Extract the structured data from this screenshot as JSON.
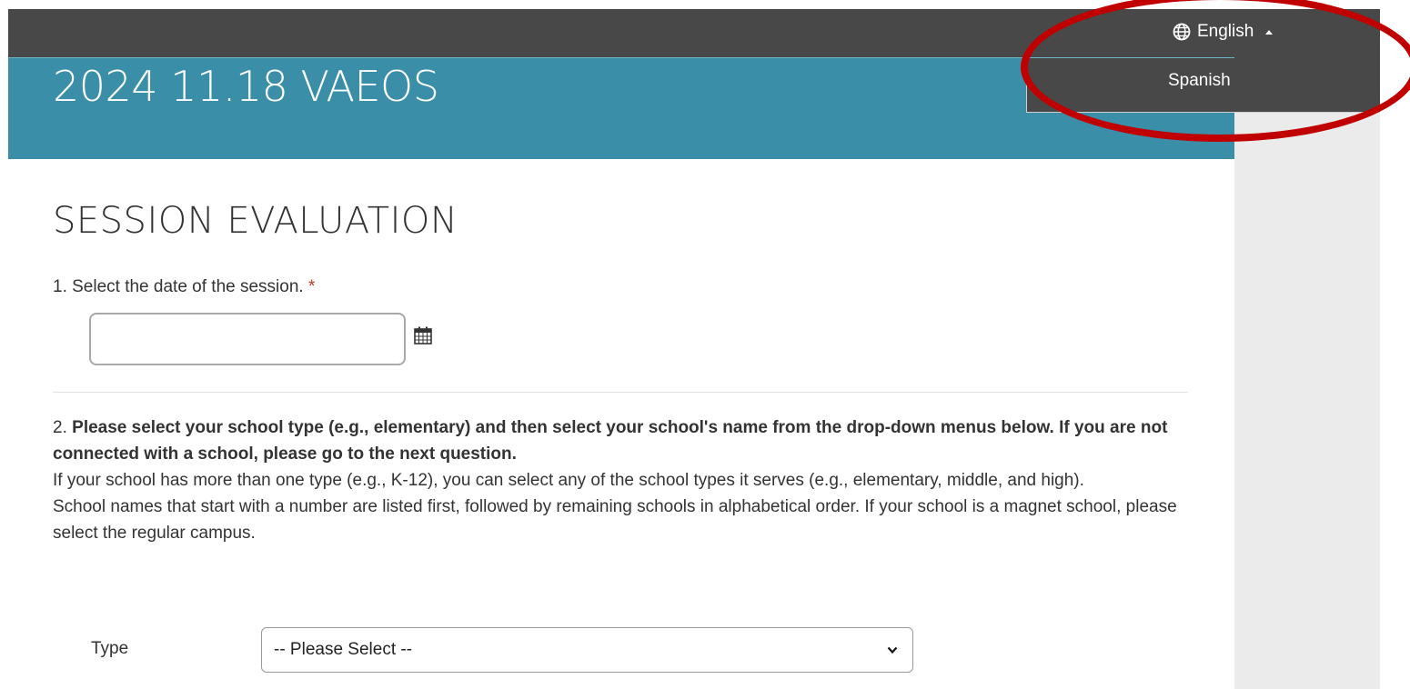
{
  "topbar": {
    "language_toggle_label": "English",
    "language_options": [
      "Spanish"
    ]
  },
  "header": {
    "title": "2024 11.18 VAEOS"
  },
  "form": {
    "heading": "SESSION EVALUATION",
    "q1": {
      "label": "1. Select the date of the session.",
      "required_marker": "*",
      "date_value": ""
    },
    "q2": {
      "number": "2.",
      "bold_text": "Please select your school type (e.g., elementary) and then select your school's name from the drop-down menus below. If you are not connected with a school, please go to the next question.",
      "help_1": "If your school has more than one type (e.g., K-12), you can select any of the school types it serves (e.g., elementary, middle, and high).",
      "help_2": "School names that start with a number are listed first, followed by remaining schools in alphabetical order. If your school is a magnet school, please select the regular campus.",
      "type_label": "Type",
      "type_selected": "-- Please Select --"
    }
  },
  "colors": {
    "topbar": "#484848",
    "header": "#3a8ea8",
    "highlight": "#c00000",
    "required": "#c0392b"
  }
}
